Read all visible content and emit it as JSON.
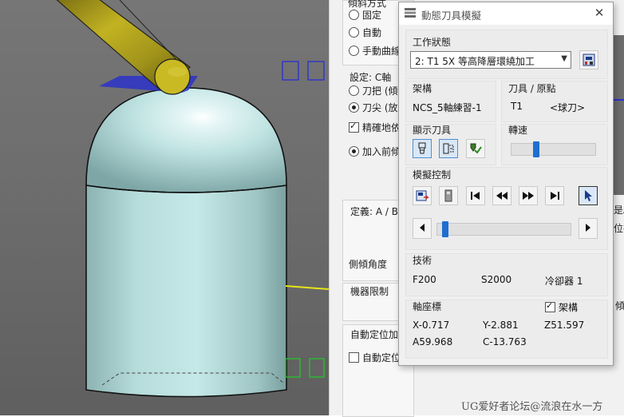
{
  "dialog": {
    "title": "動態刀具模擬",
    "work_state_label": "工作狀態",
    "work_state_value": "2: T1 5X 等高降層環繞加工",
    "structure_label": "架構",
    "structure_value": "NCS_5軸練習-1",
    "tool_origin_label": "刀具 / 原點",
    "tool_id": "T1",
    "tool_type": "<球刀>",
    "display_tool_label": "顯示刀具",
    "speed_label": "轉速",
    "speed_level": 0.28,
    "sim_control_label": "模擬控制",
    "progress_level": 0.02,
    "tech_label": "技術",
    "feed": "F200",
    "spindle": "S2000",
    "coolant": "冷卻器 1",
    "coords_label": "軸座標",
    "frame_checkbox_label": "架構",
    "frame_checked": true,
    "x": "X-0.717",
    "y": "Y-2.881",
    "z": "Z51.597",
    "a": "A59.968",
    "c": "C-13.763"
  },
  "panel": {
    "partial_heading": "傾斜方式",
    "opt_fixed": "固定",
    "opt_auto": "自動",
    "opt_manual": "手動曲線",
    "setting_c": "設定: C軸",
    "opt_handle": "刀把 (傾斜",
    "opt_tip": "刀尖 (放射",
    "chk_accurate": "精確地依",
    "opt_add_before": "加入前傾",
    "define_ab": "定義: A / B",
    "side_tilt": "側傾角度",
    "machine_limit": "機器限制",
    "auto_pos": "自動定位加",
    "auto_pos_chk": "自動定位",
    "right_a": "是A",
    "right_b": "位插",
    "right_c": "傾"
  },
  "watermark": "UG爱好者论坛@流浪在水一方",
  "colors": {
    "dome": "#bfe3e2",
    "tool_shank": "#b8a81e",
    "plane": "#2b33c8",
    "slider_accent": "#1e6fd0",
    "selected_btn": "#d9e7f6"
  },
  "icons": [
    "list-icon",
    "machine-icon",
    "tool-holder-icon",
    "tool-tip-icon",
    "tool-check-icon",
    "export-icon",
    "stock-icon",
    "skip-start-icon",
    "rewind-icon",
    "fast-forward-icon",
    "skip-end-icon",
    "cursor-icon",
    "step-back-icon",
    "step-forward-icon",
    "close-icon",
    "dropdown-icon"
  ]
}
